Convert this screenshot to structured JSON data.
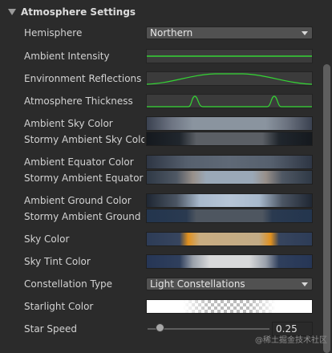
{
  "section": {
    "title": "Atmosphere Settings"
  },
  "colors": {
    "background": "#2b2b2b",
    "curve_line": "#34d534",
    "orange_accent": "#e08a1e"
  },
  "properties": {
    "hemisphere": {
      "label": "Hemisphere",
      "value": "Northern"
    },
    "ambient_intensity": {
      "label": "Ambient Intensity"
    },
    "environment_reflections": {
      "label": "Environment Reflections"
    },
    "atmosphere_thickness": {
      "label": "Atmosphere Thickness"
    },
    "ambient_sky_color": {
      "label": "Ambient Sky Color"
    },
    "stormy_ambient_sky_color": {
      "label": "Stormy Ambient Sky Color"
    },
    "ambient_equator_color": {
      "label": "Ambient Equator Color"
    },
    "stormy_ambient_equator_color": {
      "label": "Stormy Ambient Equator Co"
    },
    "ambient_ground_color": {
      "label": "Ambient Ground Color"
    },
    "stormy_ambient_ground_color": {
      "label": "Stormy Ambient Ground Co"
    },
    "sky_color": {
      "label": "Sky Color"
    },
    "sky_tint_color": {
      "label": "Sky Tint Color"
    },
    "constellation_type": {
      "label": "Constellation Type",
      "value": "Light Constellations"
    },
    "starlight_color": {
      "label": "Starlight Color"
    },
    "star_speed": {
      "label": "Star Speed",
      "value": "0.25",
      "slider_fraction": 0.1
    }
  },
  "watermark": "@稀土掘金技术社区"
}
